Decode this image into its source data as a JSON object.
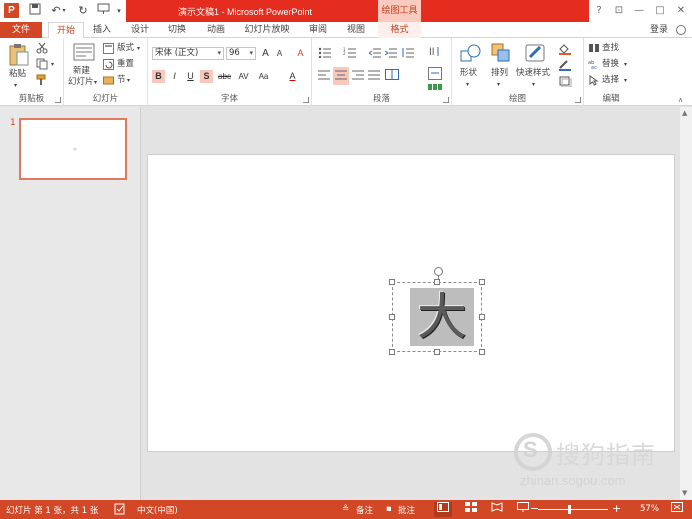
{
  "app": {
    "title": "演示文稿1 - Microsoft PowerPoint",
    "context_tab_group": "绘图工具",
    "logo_letter": "P",
    "brand_color": "#d24726",
    "title_red": "#e42d1e"
  },
  "quick_access": {
    "save_icon": "save-icon",
    "undo_icon": "undo-icon",
    "redo_icon": "redo-icon",
    "start_icon": "present-icon"
  },
  "window_controls": {
    "help": "?",
    "restore_ribbon": "⊡",
    "minimize": "—",
    "maximize": "□",
    "close": "✕"
  },
  "tabs": {
    "file": "文件",
    "items": [
      "开始",
      "插入",
      "设计",
      "切换",
      "动画",
      "幻灯片放映",
      "审阅",
      "视图",
      "格式"
    ],
    "active_index": 0,
    "login": "登录"
  },
  "ribbon": {
    "clipboard": {
      "label": "剪贴板",
      "paste": "粘贴",
      "cut_icon": "scissors-icon",
      "copy_icon": "copy-icon",
      "painter_icon": "format-painter-icon"
    },
    "slides": {
      "label": "幻灯片",
      "new_slide_line1": "新建",
      "new_slide_line2": "幻灯片",
      "layout": "版式",
      "reset": "重置",
      "section": "节"
    },
    "font": {
      "label": "字体",
      "font_name": "宋体 (正文)",
      "font_size": "96",
      "grow": "A",
      "shrink": "A",
      "clear": "A",
      "bold": "B",
      "italic": "I",
      "underline": "U",
      "shadow": "S",
      "strike": "abc",
      "spacing": "AV",
      "case": "Aa",
      "color": "A"
    },
    "paragraph": {
      "label": "段落"
    },
    "drawing": {
      "label": "绘图",
      "shapes": "形状",
      "arrange": "排列",
      "quick_styles": "快速样式"
    },
    "editing": {
      "label": "编辑",
      "find": "查找",
      "replace": "替换",
      "select": "选择"
    }
  },
  "thumbnails": [
    {
      "number": "1"
    }
  ],
  "slide": {
    "text": "大"
  },
  "watermark": {
    "logo_letter": "S",
    "text": "搜狗指南",
    "url": "zhinan.sogou.com"
  },
  "status": {
    "slide_info": "幻灯片 第 1 张，共 1 张",
    "language": "中文(中国)",
    "notes": "备注",
    "comments": "批注",
    "zoom": "57%",
    "zoom_minus": "−",
    "zoom_plus": "+"
  }
}
